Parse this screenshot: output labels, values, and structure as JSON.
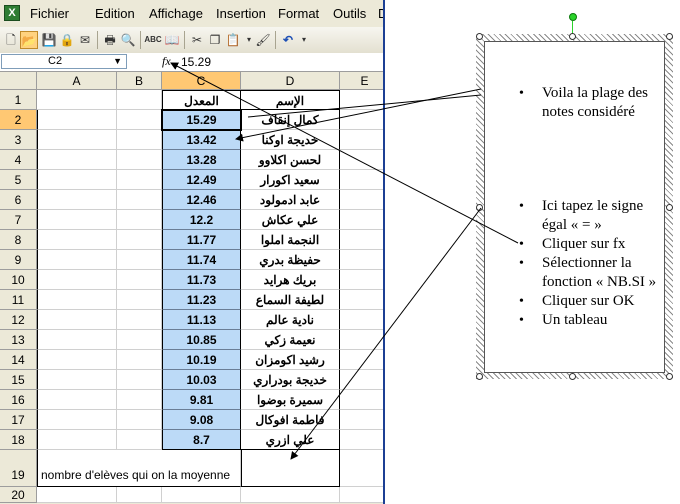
{
  "menu": {
    "app_icon": "excel-icon",
    "items": [
      "Fichier",
      "Edition",
      "Affichage",
      "Insertion",
      "Format",
      "Outils",
      "D"
    ]
  },
  "formula_bar": {
    "name_box": "C2",
    "fx": "fx",
    "value": "15.29"
  },
  "columns": [
    "A",
    "B",
    "C",
    "D",
    "E"
  ],
  "rows": [
    "1",
    "2",
    "3",
    "4",
    "5",
    "6",
    "7",
    "8",
    "9",
    "10",
    "11",
    "12",
    "13",
    "14",
    "15",
    "16",
    "17",
    "18",
    "19",
    "20"
  ],
  "sheet": {
    "header_c": "المعدل",
    "header_d": "الإسم",
    "values": [
      "15.29",
      "13.42",
      "13.28",
      "12.49",
      "12.46",
      "12.2",
      "11.77",
      "11.74",
      "11.73",
      "11.23",
      "11.13",
      "10.85",
      "10.19",
      "10.03",
      "9.81",
      "9.08",
      "8.7"
    ],
    "names": [
      "كمال إنقاف",
      "خديجة اوكنا",
      "لحسن اكلاوو",
      "سعيد اكورار",
      "عابد ادمولود",
      "علي عكاش",
      "النجمة املوا",
      "حفيظة بدري",
      "بريك هرايد",
      "لطيفة السماع",
      "نادية عالم",
      "نعيمة زكي",
      "رشيد اكومزان",
      "خديجة بودراري",
      "سميرة بوضوا",
      "فاطمة افوكال",
      "علي ازري"
    ],
    "row19_label": "nombre d'elèves qui on la moyenne"
  },
  "textbox": {
    "bullets": [
      "Voila la plage des notes considéré",
      "Ici tapez  le signe égal  « = »",
      "Cliquer sur fx",
      "Sélectionner la fonction « NB.SI »",
      "Cliquer sur OK",
      "Un tableau"
    ]
  },
  "colors": {
    "value_fill": "#bcdaf7",
    "selected_header": "#ffc873",
    "window_border": "#1c3f94"
  }
}
